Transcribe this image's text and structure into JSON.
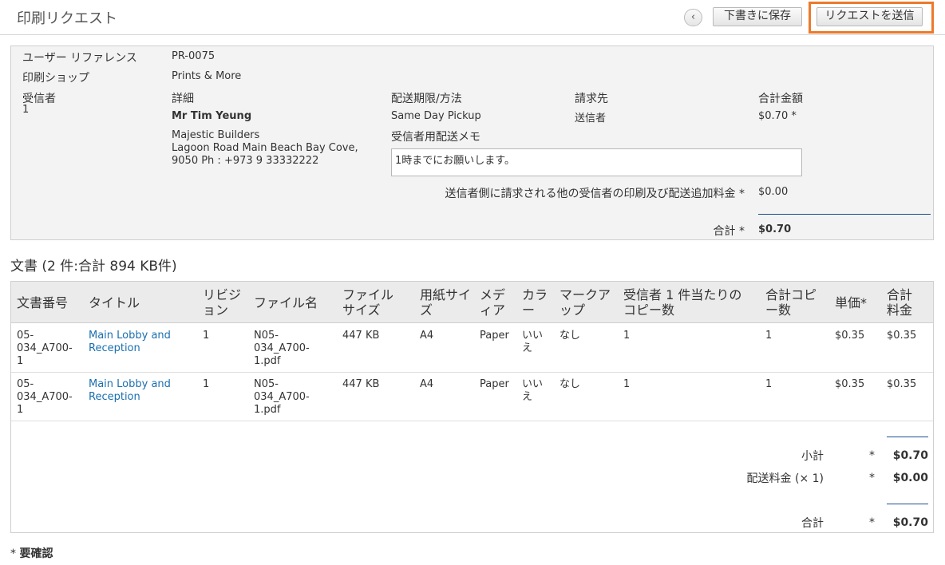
{
  "header": {
    "title": "印刷リクエスト",
    "back_glyph": "‹",
    "save_draft_label": "下書きに保存",
    "send_request_label": "リクエストを送信"
  },
  "summary": {
    "user_reference_label": "ユーザー リファレンス",
    "user_reference_value": "PR-0075",
    "print_shop_label": "印刷ショップ",
    "print_shop_value": "Prints & More",
    "recipient_label": "受信者",
    "recipient_number": "1",
    "details_label": "詳細",
    "recipient_name": "Mr Tim Yeung",
    "company": "Majestic Builders",
    "address_line1": "Lagoon Road Main Beach Bay Cove,",
    "address_line2": "9050 Ph : +973 9 33332222",
    "delivery_label": "配送期限/方法",
    "delivery_value": "Same Day Pickup",
    "billing_label": "請求先",
    "billing_value": "送信者",
    "amount_label": "合計金額",
    "amount_value": "$0.70 *",
    "memo_label": "受信者用配送メモ",
    "memo_value": "1時までにお願いします。",
    "extra_charge_label": "送信者側に請求される他の受信者の印刷及び配送追加料金 *",
    "extra_charge_value": "$0.00",
    "total_label": "合計 *",
    "total_value": "$0.70"
  },
  "documents": {
    "heading": "文書 (2 件:合計 894 KB件)",
    "headers": {
      "doc_number": "文書番号",
      "title": "タイトル",
      "revision_1": "リビジ",
      "revision_2": "ョン",
      "file_name": "ファイル名",
      "file_size_1": "ファイル",
      "file_size_2": "サイズ",
      "paper_size_1": "用紙サイ",
      "paper_size_2": "ズ",
      "media_1": "メデ",
      "media_2": "ィア",
      "color_1": "カラ",
      "color_2": "ー",
      "markup_1": "マークア",
      "markup_2": "ップ",
      "copies_per_1": "受信者 1 件当たりの",
      "copies_per_2": "コピー数",
      "total_copies_1": "合計コピ",
      "total_copies_2": "ー数",
      "unit_price": "単価*",
      "total_fee_1": "合計",
      "total_fee_2": "料金"
    },
    "rows": [
      {
        "doc_number": [
          "05-",
          "034_A700-",
          "1"
        ],
        "title": [
          "Main Lobby and",
          "Reception"
        ],
        "revision": "1",
        "file_name": [
          "N05-",
          "034_A700-",
          "1.pdf"
        ],
        "file_size": "447 KB",
        "paper_size": "A4",
        "media": "Paper",
        "color": [
          "いい",
          "え"
        ],
        "markup": "なし",
        "copies_per": "1",
        "total_copies": "1",
        "unit_price": "$0.35",
        "total_fee": "$0.35"
      },
      {
        "doc_number": [
          "05-",
          "034_A700-",
          "1"
        ],
        "title": [
          "Main Lobby and",
          "Reception"
        ],
        "revision": "1",
        "file_name": [
          "N05-",
          "034_A700-",
          "1.pdf"
        ],
        "file_size": "447 KB",
        "paper_size": "A4",
        "media": "Paper",
        "color": [
          "いい",
          "え"
        ],
        "markup": "なし",
        "copies_per": "1",
        "total_copies": "1",
        "unit_price": "$0.35",
        "total_fee": "$0.35"
      }
    ],
    "totals": {
      "subtotal_label": "小計",
      "subtotal_star": "*",
      "subtotal_value": "$0.70",
      "shipping_label": "配送料金 (× 1)",
      "shipping_star": "*",
      "shipping_value": "$0.00",
      "total_label": "合計",
      "total_star": "*",
      "total_value": "$0.70"
    }
  },
  "footer": {
    "required_star": "*",
    "required_note": "要確認"
  },
  "colors": {
    "highlight": "#ec7a2b",
    "link": "#1a6fb0",
    "total_rule": "#1e4f8f"
  }
}
